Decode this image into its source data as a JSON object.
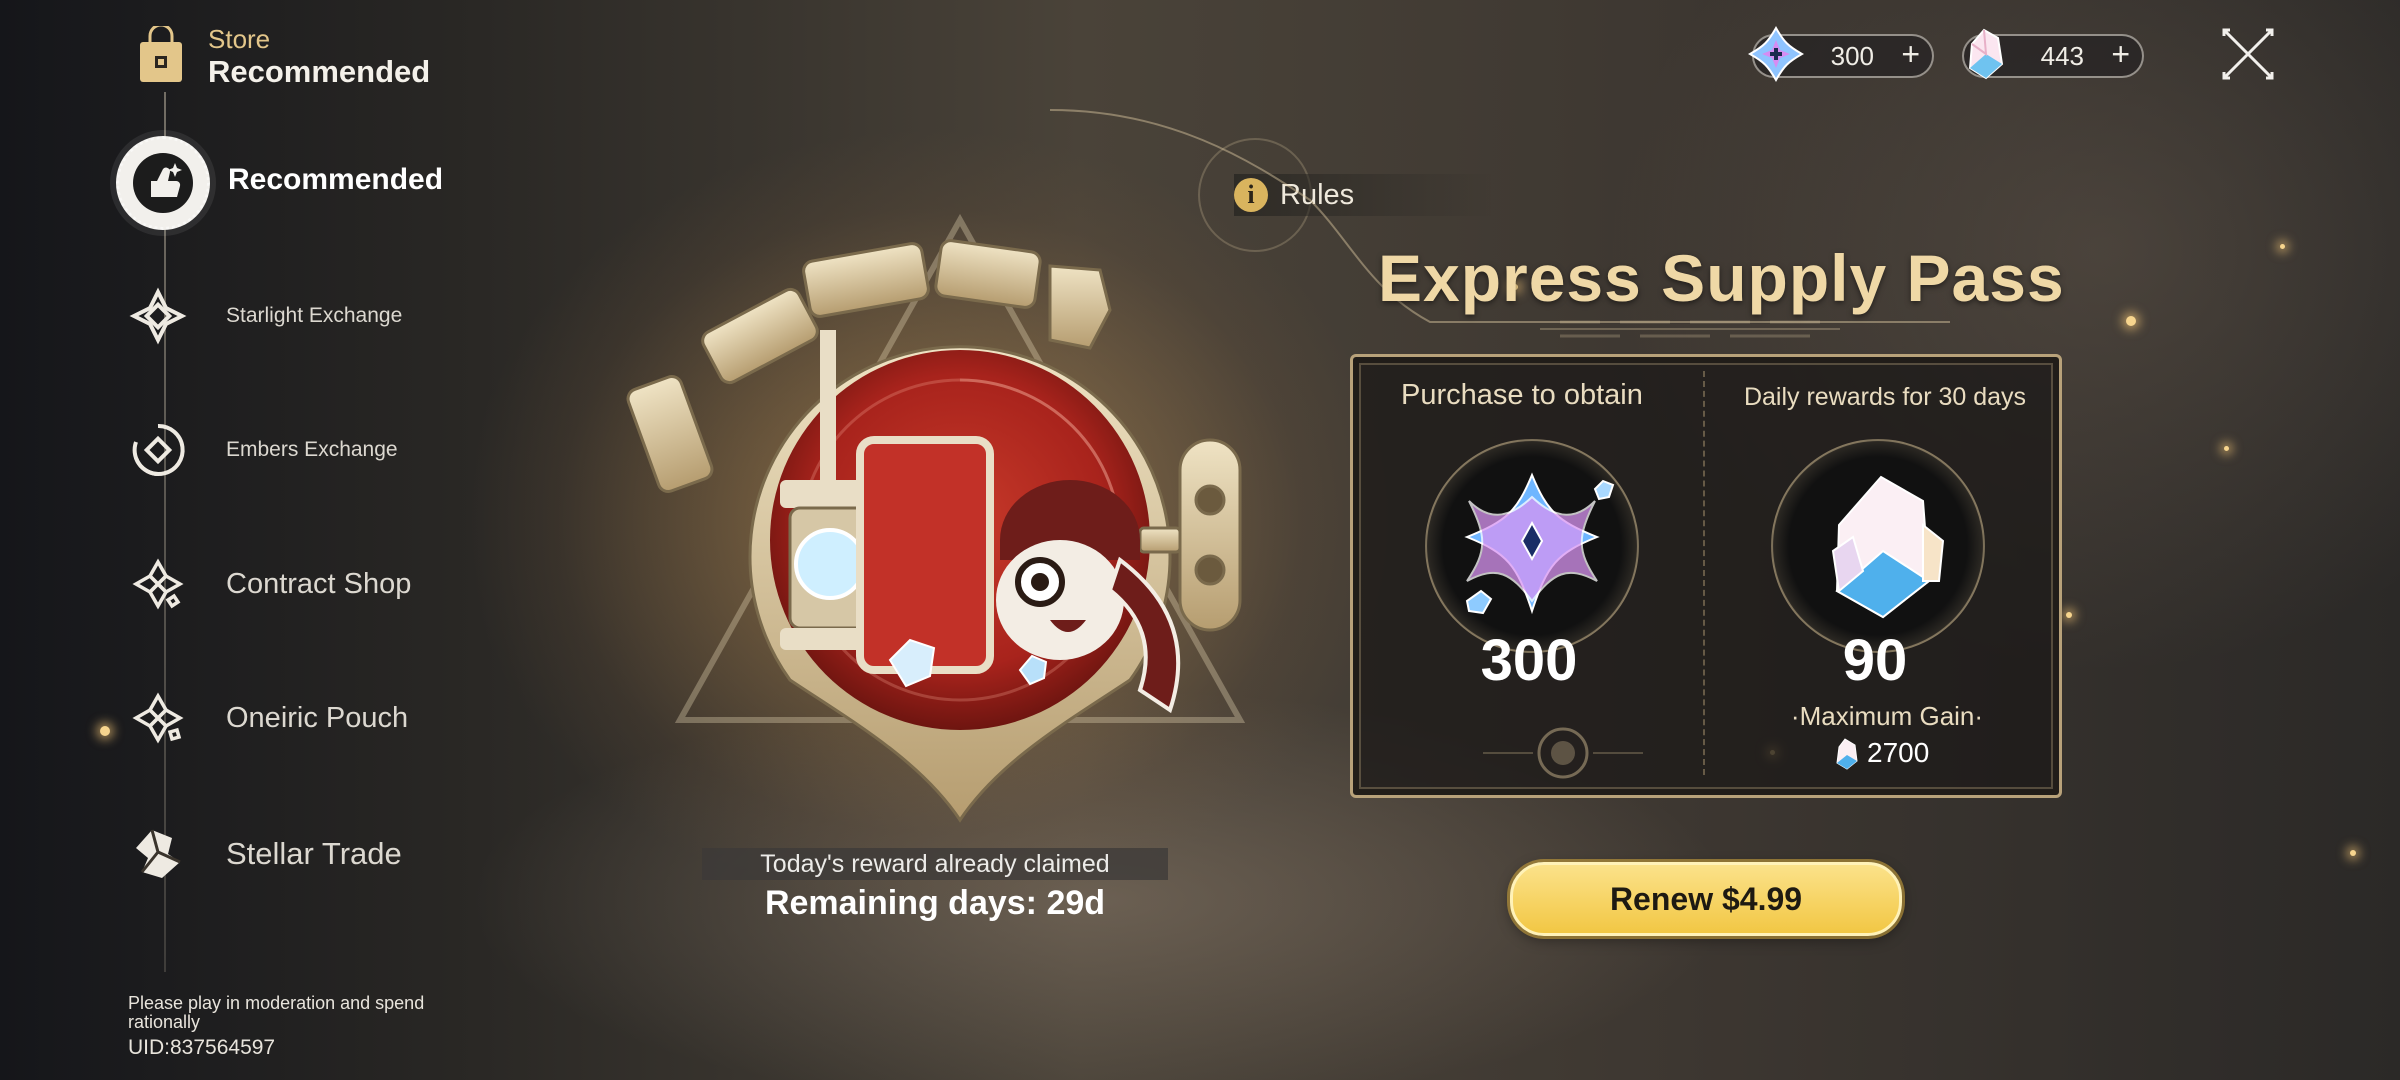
{
  "sidebar": {
    "header": {
      "label": "Store",
      "sub": "Recommended",
      "icon": "shopping-bag-icon"
    },
    "items": [
      {
        "label": "Recommended",
        "icon": "recommended-icon",
        "active": true
      },
      {
        "label": "Starlight Exchange",
        "icon": "starlight-icon"
      },
      {
        "label": "Embers Exchange",
        "icon": "embers-icon"
      },
      {
        "label": "Contract Shop",
        "icon": "contract-icon"
      },
      {
        "label": "Oneiric Pouch",
        "icon": "oneiric-icon"
      },
      {
        "label": "Stellar Trade",
        "icon": "stellar-icon"
      }
    ],
    "notice": "Please play in moderation and spend rationally",
    "uid": "UID:837564597"
  },
  "currency": [
    {
      "icon": "stellar-jade-icon",
      "value": "300",
      "plus": "+"
    },
    {
      "icon": "oneiric-shard-icon",
      "value": "443",
      "plus": "+"
    }
  ],
  "rules": {
    "icon": "info-icon",
    "glyph": "i",
    "label": "Rules"
  },
  "title": "Express Supply Pass",
  "rewards": {
    "purchase": {
      "title": "Purchase to obtain",
      "amount": "300",
      "icon": "stellar-jade-icon"
    },
    "daily": {
      "title": "Daily rewards for 30 days",
      "amount": "90",
      "icon": "oneiric-shard-icon"
    },
    "max_gain_label": "·Maximum Gain·",
    "max_gain_value": "2700"
  },
  "status": {
    "claimed": "Today's reward already claimed",
    "remaining": "Remaining days: 29d"
  },
  "renew_label": "Renew $4.99",
  "colors": {
    "accent_gold": "#efd8a6",
    "button_yellow": "#f2c744",
    "emblem_red": "#a8231c"
  }
}
